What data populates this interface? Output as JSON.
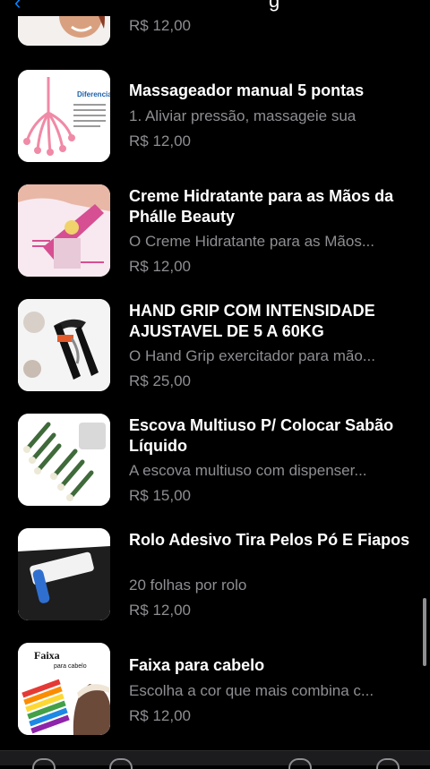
{
  "top": {
    "title_fragment": "g"
  },
  "items": [
    {
      "name": "",
      "desc": "",
      "price": "R$ 12,00",
      "image": "woman-smiling-photo"
    },
    {
      "name": "Massageador manual 5 pontas",
      "desc": "1. Aliviar pressão, massageie sua",
      "price": "R$ 12,00",
      "image": "pink-massager-diagram",
      "image_title": "Diferencial"
    },
    {
      "name": "Creme Hidratante para as Mãos da Phálle Beauty",
      "desc": "O Creme Hidratante para as Mãos...",
      "price": "R$ 12,00",
      "image": "hand-cream-photo"
    },
    {
      "name": "HAND GRIP COM INTENSIDADE AJUSTAVEL DE 5 A 60KG",
      "desc": "O Hand Grip exercitador para mão...",
      "price": "R$ 25,00",
      "image": "hand-grip-photo"
    },
    {
      "name": "Escova Multiuso P/ Colocar Sabão Líquido",
      "desc": "A escova multiuso com dispenser...",
      "price": "R$ 15,00",
      "image": "brushes-photo"
    },
    {
      "name": "Rolo Adesivo Tira Pelos Pó E Fiapos",
      "desc": "20 folhas por rolo",
      "price": "R$ 12,00",
      "image": "lint-roller-photo"
    },
    {
      "name": "Faixa para cabelo",
      "desc": "Escolha a cor que mais combina c...",
      "price": "R$ 12,00",
      "image": "headband-photo",
      "image_title": "Faixa",
      "image_subtitle": "para cabelo"
    }
  ],
  "colors": {
    "accent": "#0a84ff",
    "secondary_text": "#8e8e93",
    "background": "#000000"
  }
}
